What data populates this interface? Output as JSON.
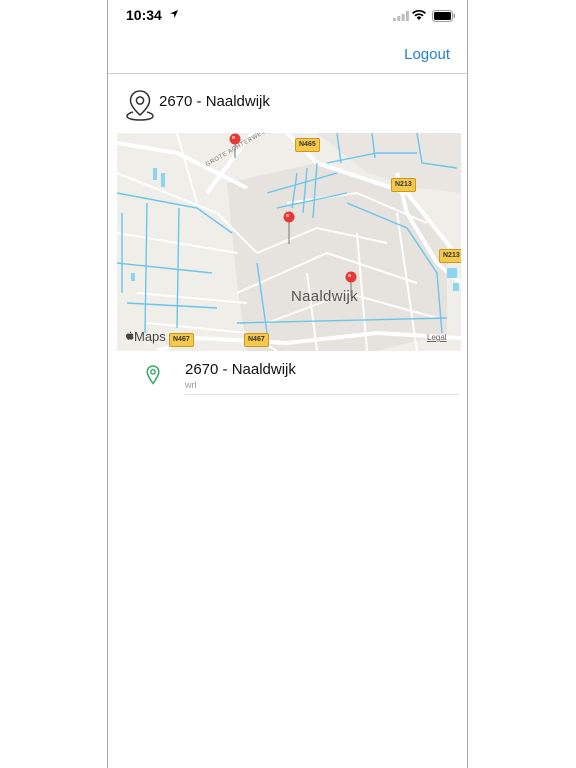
{
  "status_bar": {
    "time": "10:34",
    "icons": [
      "location-arrow-icon",
      "cellular-signal-icon",
      "wifi-icon",
      "battery-icon"
    ]
  },
  "nav": {
    "logout_label": "Logout",
    "accent_color": "#1f7fd6"
  },
  "header": {
    "icon": "map-pin-outline-icon",
    "title": "2670 - Naaldwijk"
  },
  "map": {
    "city_label": "Naaldwijk",
    "street_label": "GROTE ACHTERWEG",
    "road_shields": [
      "N465",
      "N213",
      "N213",
      "N467",
      "N467"
    ],
    "attribution": "Maps",
    "legal_label": "Legal",
    "pin_color": "#e53935",
    "pin_count": 3
  },
  "list": {
    "items": [
      {
        "icon": "map-pin-green-icon",
        "title": "2670 - Naaldwijk",
        "subtitle": "wrl",
        "icon_color": "#3fae6a"
      }
    ]
  }
}
